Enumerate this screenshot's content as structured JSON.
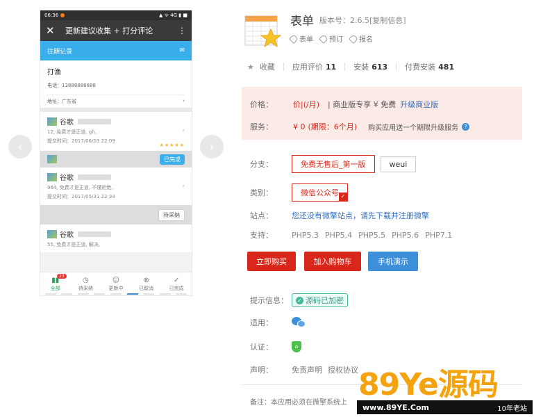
{
  "preview": {
    "status_time": "06:36",
    "status_right": "▲ ᯤ 4G ▮ ■",
    "app_bar_title": "更新建议收集 + 打分评论",
    "history_label": "往期记录",
    "profile_name": "打渔",
    "profile_phone": "电话：13888888888",
    "profile_addr": "地址：广东省",
    "cards": [
      {
        "name": "谷歌",
        "line1": "12, 免费才是正道, gh,",
        "line2": "提交时间：2017/06/03 22:09",
        "stars": "★★★★★"
      },
      {
        "name": "谷歌",
        "line1": "964, 免费才是正道, 不懂拒绝,",
        "line2": "提交时间：2017/05/31 22:34"
      },
      {
        "name": "谷歌",
        "line1": "55, 免费才是正道, 解决,"
      }
    ],
    "stage_done": "已完成",
    "stage_pending": "待采纳",
    "tabs": [
      {
        "label": "全部",
        "icon": "bar-chart-icon"
      },
      {
        "label": "待采纳",
        "icon": "clock-icon"
      },
      {
        "label": "更新中",
        "icon": "person-icon"
      },
      {
        "label": "已取消",
        "icon": "cancel-icon"
      },
      {
        "label": "已完成",
        "icon": "check-icon"
      }
    ],
    "tab_badge": "23",
    "nav_prev": "‹",
    "nav_next": "›"
  },
  "product": {
    "name": "表单",
    "version": "版本号：2.6.5[复制信息]",
    "tags": [
      "表单",
      "预订",
      "报名"
    ],
    "collect_label": "收藏",
    "rating_label": "应用评价",
    "rating_value": "11",
    "install_label": "安装",
    "install_value": "613",
    "paid_label": "付费安装",
    "paid_value": "481"
  },
  "price": {
    "price_label": "价格：",
    "price_text": "价|(/月)",
    "pro_text": "| 商业版专享 ¥ 免费",
    "upgrade_link": "升级商业版",
    "service_label": "服务：",
    "service_value": "¥ 0",
    "service_period": "(期限：6个月)",
    "service_note": "购买应用送一个期限升级服务",
    "help_icon": "?"
  },
  "details": {
    "branch_label": "分支：",
    "branch_options": [
      "免费无售后_第一版",
      "weui"
    ],
    "category_label": "类别：",
    "category_value": "微信公众号",
    "site_label": "站点：",
    "site_link": "您还没有微擎站点，请先下载并注册微擎",
    "support_label": "支持：",
    "php_versions": [
      "PHP5.3",
      "PHP5.4",
      "PHP5.5",
      "PHP5.6",
      "PHP7.1"
    ]
  },
  "actions": {
    "buy": "立即购买",
    "cart": "加入购物车",
    "demo": "手机演示"
  },
  "extra": {
    "tip_label": "提示信息：",
    "tip_badge": "源码已加密",
    "apply_label": "适用：",
    "cert_label": "认证：",
    "declare_label": "声明：",
    "declare_links": [
      "免责声明",
      "授权协议"
    ],
    "note": "备注：本应用必须在微擎系统上"
  },
  "watermark": {
    "brand": "89Ye源码",
    "url": "www.89YE.Com",
    "slogan": "10年老站"
  }
}
